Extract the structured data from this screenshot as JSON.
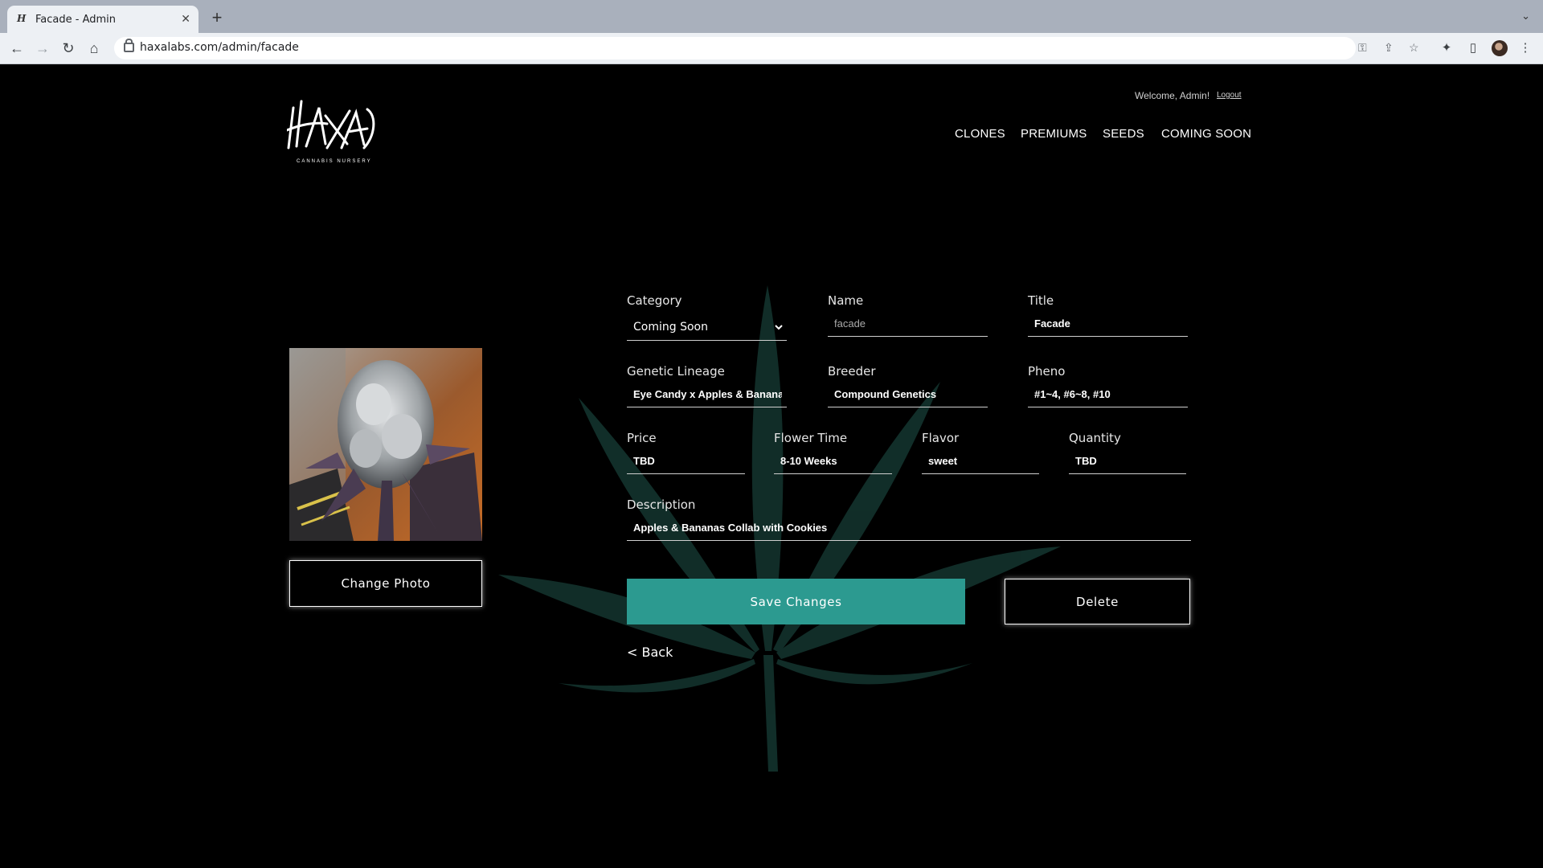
{
  "browser": {
    "tab_title": "Facade - Admin",
    "url": "haxalabs.com/admin/facade",
    "icons": [
      "back-icon",
      "forward-icon",
      "reload-icon",
      "home-icon",
      "lock-icon",
      "key-icon",
      "share-icon",
      "star-icon",
      "extensions-icon",
      "sidepanel-icon",
      "profile-avatar",
      "menu-icon"
    ]
  },
  "header": {
    "logo_text": "HAXA",
    "logo_subtext": "CANNABIS NURSERY",
    "welcome": "Welcome, Admin!",
    "logout": "Logout",
    "nav": [
      "CLONES",
      "PREMIUMS",
      "SEEDS",
      "COMING SOON"
    ]
  },
  "photo": {
    "change_label": "Change Photo"
  },
  "form": {
    "category": {
      "label": "Category",
      "value": "Coming Soon"
    },
    "name": {
      "label": "Name",
      "placeholder": "facade"
    },
    "title": {
      "label": "Title",
      "value": "Facade"
    },
    "lineage": {
      "label": "Genetic Lineage",
      "value": "Eye Candy x Apples & Bananas"
    },
    "breeder": {
      "label": "Breeder",
      "value": "Compound Genetics"
    },
    "pheno": {
      "label": "Pheno",
      "value": "#1~4, #6~8, #10"
    },
    "price": {
      "label": "Price",
      "value": "TBD"
    },
    "flower_time": {
      "label": "Flower Time",
      "value": "8-10 Weeks"
    },
    "flavor": {
      "label": "Flavor",
      "value": "sweet"
    },
    "quantity": {
      "label": "Quantity",
      "value": "TBD"
    },
    "description": {
      "label": "Description",
      "value": "Apples & Bananas Collab with Cookies"
    }
  },
  "actions": {
    "save": "Save Changes",
    "delete": "Delete",
    "back": "< Back"
  },
  "colors": {
    "background": "#000000",
    "accent": "#2c9a90",
    "leaf": "#12302b"
  }
}
